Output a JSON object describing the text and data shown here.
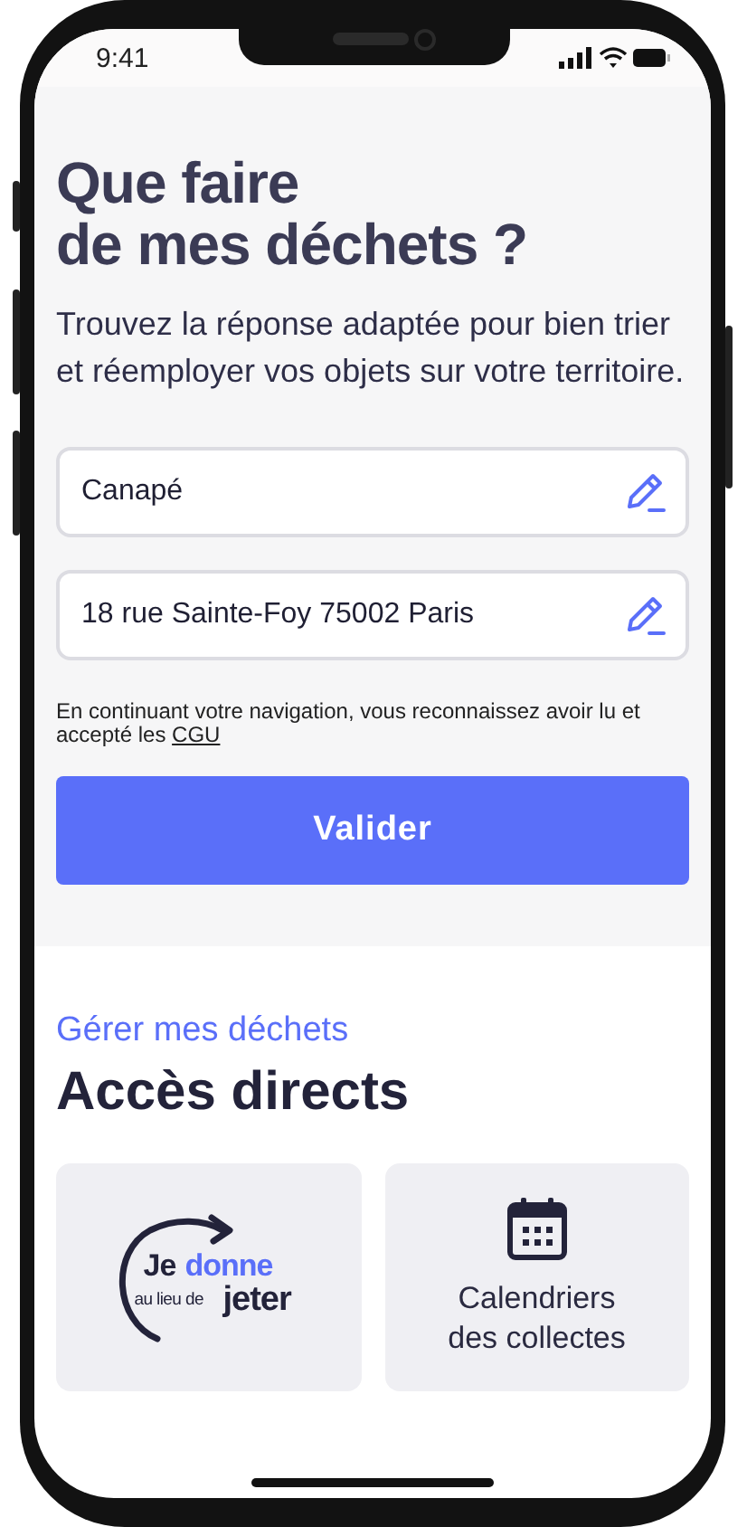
{
  "status_bar": {
    "time": "9:41"
  },
  "hero": {
    "title_lines": [
      "Que faire",
      "de mes déchets ?"
    ],
    "subtitle": "Trouvez la réponse adaptée pour bien trier et réemployer vos objets sur votre territoire."
  },
  "fields": [
    {
      "value": "Canapé"
    },
    {
      "value": "18 rue Sainte-Foy 75002 Paris"
    }
  ],
  "legal": {
    "text": "En continuant votre navigation, vous reconnaissez avoir lu et accepté les",
    "link": "CGU"
  },
  "submit_button": "Valider",
  "section": {
    "eyebrow": "Gérer mes déchets",
    "title": "Accès directs"
  },
  "tiles": [
    {
      "kind": "logo",
      "logo": {
        "word_1": "Je",
        "word_2": "donne",
        "word_3": "au lieu de",
        "word_4": "jeter"
      }
    },
    {
      "kind": "calendar",
      "label_lines": [
        "Calendriers",
        "des collectes"
      ]
    }
  ]
}
